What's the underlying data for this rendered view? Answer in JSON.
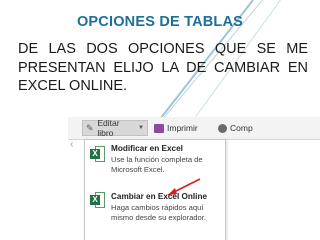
{
  "slide": {
    "title": "OPCIONES DE TABLAS",
    "body": "DE LAS DOS OPCIONES QUE SE ME PRESENTAN ELIJO LA DE CAMBIAR EN EXCEL ONLINE."
  },
  "toolbar": {
    "edit_label": "Editar libro",
    "print_label": "Imprimir",
    "share_label": "Comp"
  },
  "menu": {
    "items": [
      {
        "title": "Modificar en Excel",
        "description": "Use la función completa de Microsoft Excel."
      },
      {
        "title": "Cambiar en Excel Online",
        "description": "Haga cambios rápidos aquí mismo desde su explorador."
      }
    ]
  },
  "icons": {
    "edit": "pencil-icon",
    "print": "printer-icon",
    "share": "share-icon",
    "excel": "excel-icon",
    "chevron": "chevron-left-icon"
  },
  "colors": {
    "title": "#1c6f9a",
    "excel_green": "#217346",
    "arrow_red": "#d02020"
  }
}
